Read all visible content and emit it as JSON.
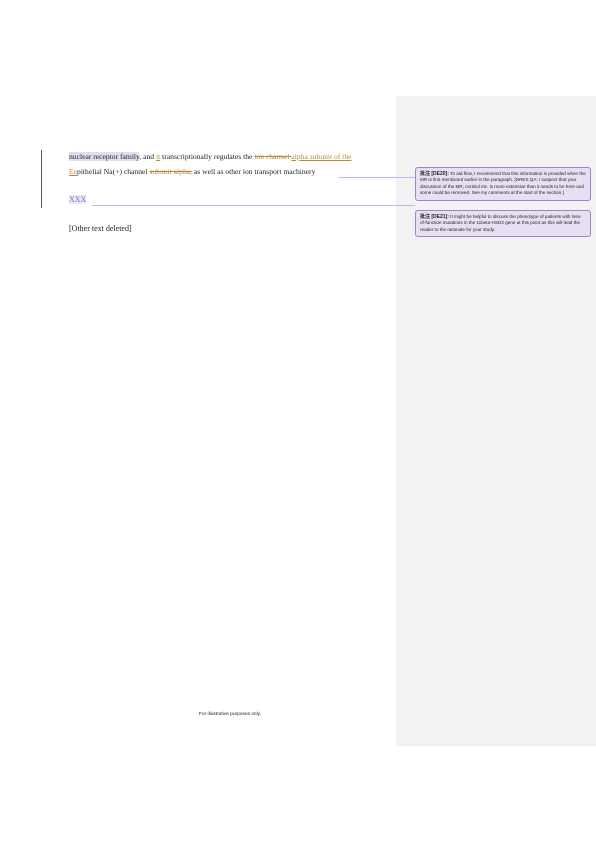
{
  "document": {
    "line1": {
      "t1": "nuclear receptor family",
      "t2": ", and ",
      "ins1": "it",
      "t3": " transcriptionally regulates the ",
      "del1": "ion channel ",
      "ins2": "alpha subunit of the"
    },
    "line2": {
      "ins3": "Ee",
      "t1": "pithelial Na(+) channel ",
      "del1": "subunit alpha,",
      "t2": " as well as other ion transport machinery"
    },
    "placeholder": "XXX",
    "other_text": "[Other text deleted]"
  },
  "comments": [
    {
      "tag": "批注 [DE20]:",
      "text": " To aid flow, I recommend that this information is provided when the MR is first mentioned earlier in the paragraph. [NRES QA: I suspect that your discussion of the MR, cortisol etc. is more extensive than it needs to be here and some could be removed. See my comments at the start of the section.]"
    },
    {
      "tag": "批注 [DE21]:",
      "text": " It might be helpful to discuss the phenotype of patients with loss-of-function mutations in the 11beta-HSD2 gene at this point as this will lead the reader to the rationale for your study."
    }
  ],
  "footer": "For illustrative purposes only."
}
